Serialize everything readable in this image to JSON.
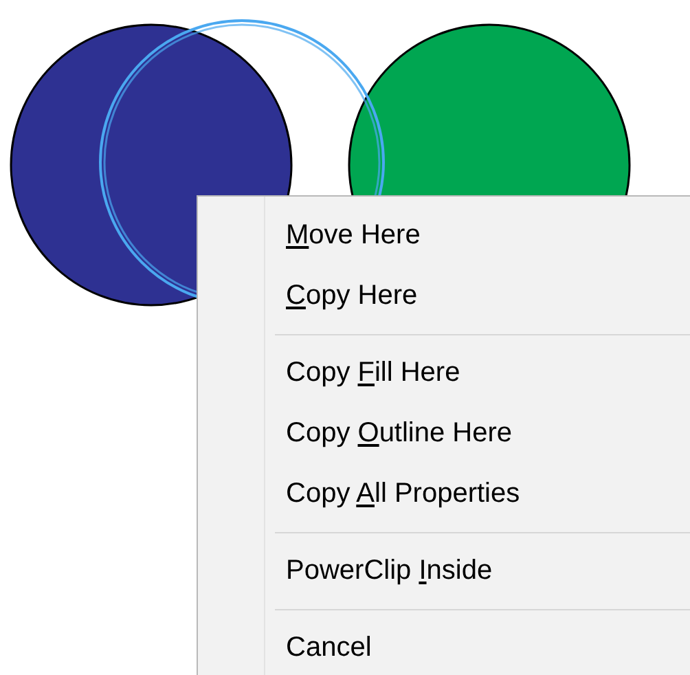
{
  "canvas": {
    "shapes": [
      {
        "kind": "filled",
        "color": "#2e3192"
      },
      {
        "kind": "filled",
        "color": "#00a651"
      },
      {
        "kind": "ghost",
        "color": "#4aa8f0"
      }
    ]
  },
  "context_menu": {
    "items": [
      {
        "kind": "item",
        "key": "M",
        "post": "ove Here"
      },
      {
        "kind": "item",
        "key": "C",
        "post": "opy Here"
      },
      {
        "kind": "separator"
      },
      {
        "kind": "item",
        "pre": "Copy ",
        "key": "F",
        "post": "ill Here"
      },
      {
        "kind": "item",
        "pre": "Copy ",
        "key": "O",
        "post": "utline Here"
      },
      {
        "kind": "item",
        "pre": "Copy ",
        "key": "A",
        "post": "ll Properties"
      },
      {
        "kind": "separator"
      },
      {
        "kind": "item",
        "pre": "PowerClip ",
        "key": "I",
        "post": "nside"
      },
      {
        "kind": "separator"
      },
      {
        "kind": "item",
        "pre": "Cancel"
      }
    ]
  }
}
